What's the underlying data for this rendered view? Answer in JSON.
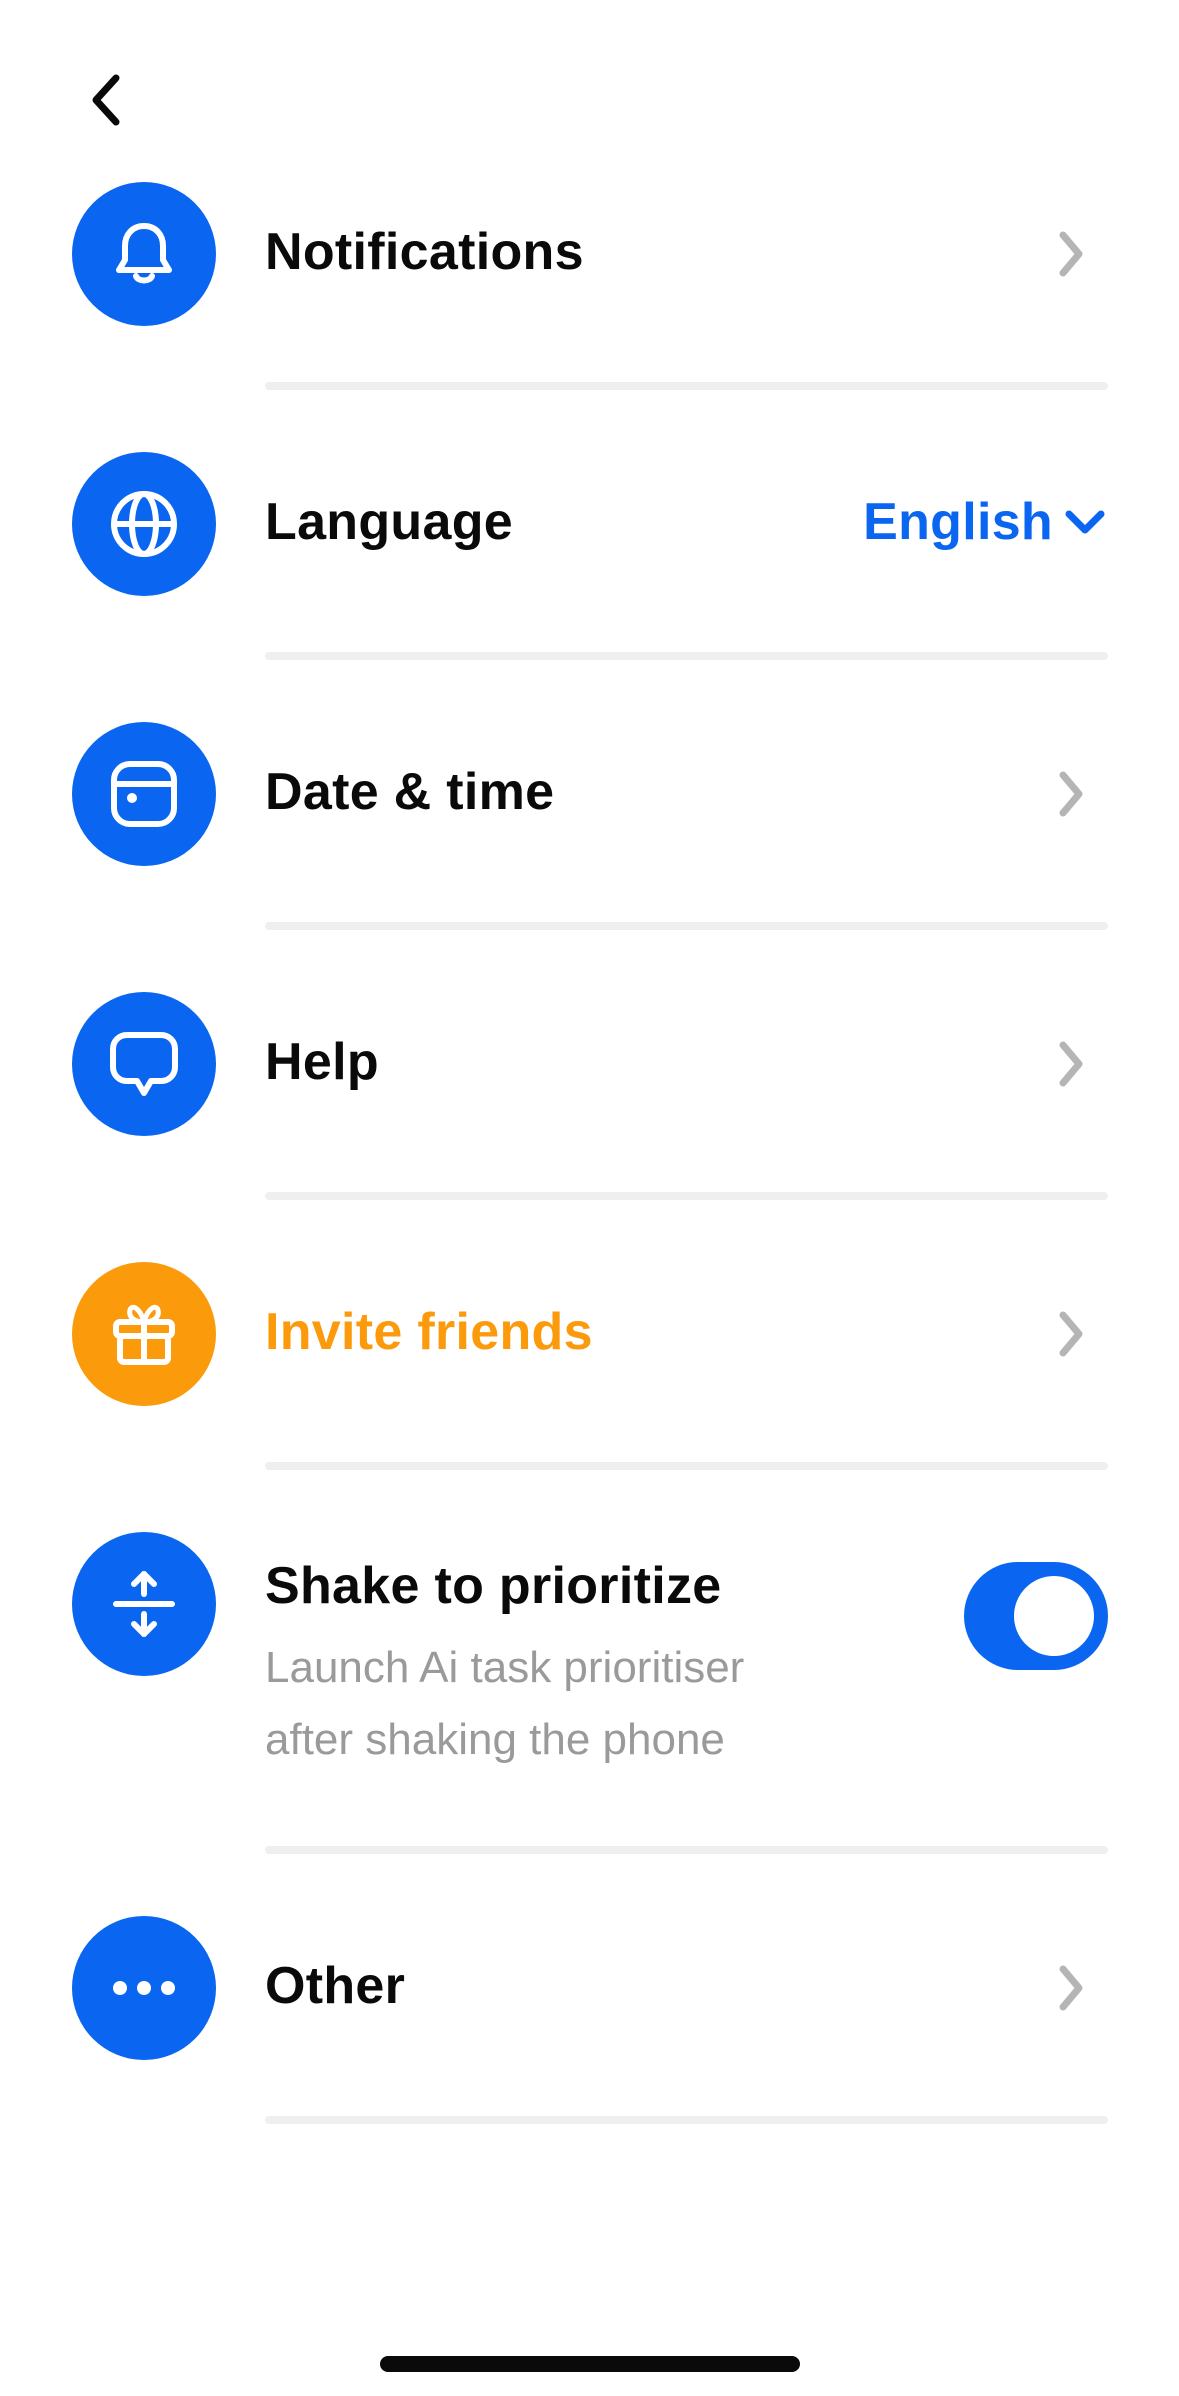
{
  "colors": {
    "accent_blue": "#0a66f0",
    "accent_orange": "#fb9a0a",
    "divider": "#efefef",
    "chevron": "#b5b5b5",
    "subtext": "#9a9a9a"
  },
  "header": {
    "back_icon": "chevron-left-icon"
  },
  "settings": {
    "notifications": {
      "label": "Notifications",
      "icon": "bell-icon"
    },
    "language": {
      "label": "Language",
      "icon": "globe-icon",
      "value": "English",
      "value_icon": "chevron-down-icon"
    },
    "date_time": {
      "label": "Date & time",
      "icon": "calendar-icon"
    },
    "help": {
      "label": "Help",
      "icon": "chat-bubble-icon"
    },
    "invite": {
      "label": "Invite friends",
      "icon": "gift-icon"
    },
    "shake": {
      "label": "Shake to prioritize",
      "icon": "shake-arrows-icon",
      "description_line1": "Launch Ai task prioritiser",
      "description_line2": "after shaking the phone",
      "toggle_on": true
    },
    "other": {
      "label": "Other",
      "icon": "more-dots-icon"
    }
  }
}
